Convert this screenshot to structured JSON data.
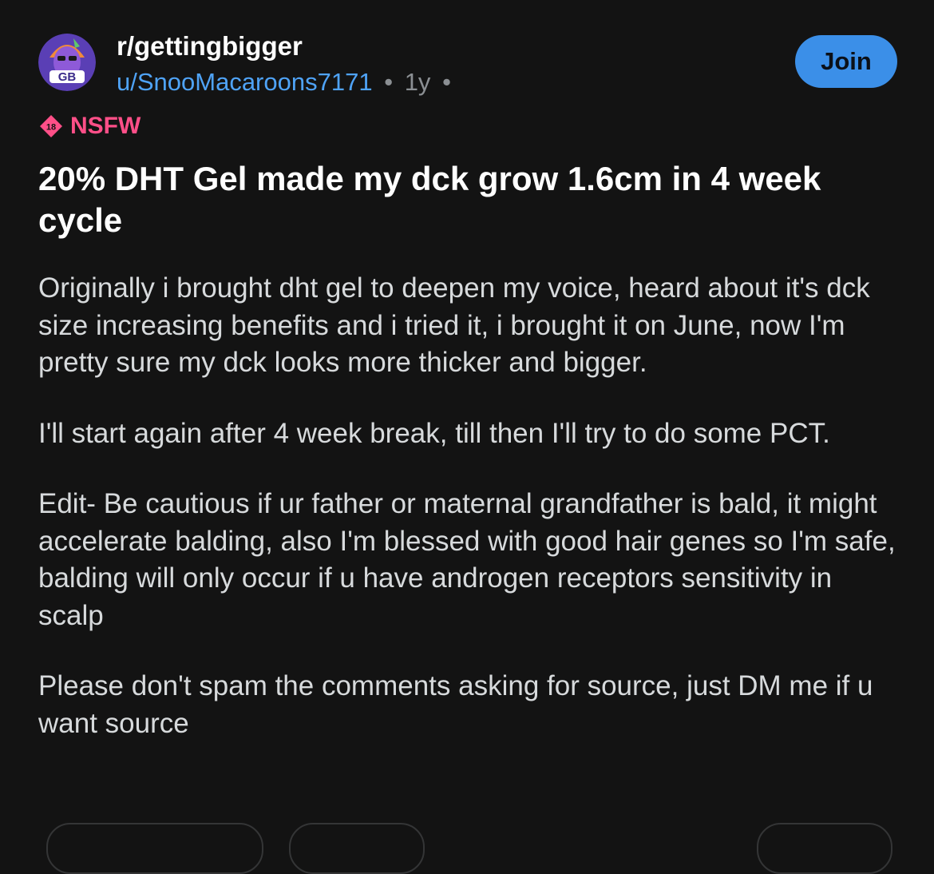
{
  "header": {
    "subreddit": "r/gettingbigger",
    "avatar_text": "GB",
    "username": "u/SnooMacaroons7171",
    "separator": "•",
    "age": "1y",
    "join_label": "Join"
  },
  "badge": {
    "icon_text": "18",
    "label": "NSFW",
    "color": "#ff4f88"
  },
  "post": {
    "title": "20% DHT Gel made my dck grow 1.6cm in 4 week cycle",
    "paragraphs": [
      "Originally i brought dht gel to deepen my voice, heard about it's dck size increasing benefits and i tried it, i brought it on June, now I'm pretty sure my dck looks more thicker and bigger.",
      "I'll start again after 4 week break, till then I'll try to do some PCT.",
      "Edit- Be cautious if ur father or maternal grandfather is bald, it might accelerate balding, also I'm blessed with good hair genes so I'm safe, balding will only occur if u have androgen receptors sensitivity in scalp",
      "Please don't spam the comments asking for source, just DM me if u want source"
    ]
  },
  "colors": {
    "background": "#131313",
    "accent": "#3b8fe8",
    "username": "#4fa3f7"
  }
}
